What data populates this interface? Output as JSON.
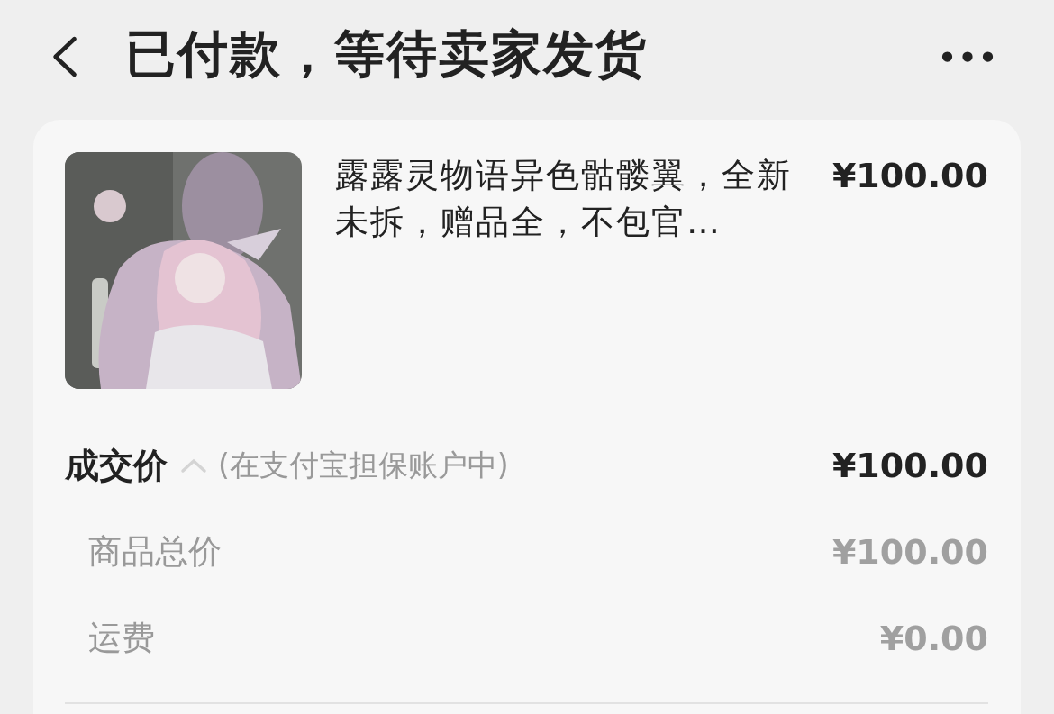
{
  "header": {
    "title": "已付款，等待卖家发货"
  },
  "item": {
    "kind": "picture",
    "title": "露露灵物语异色骷髅翼，全新未拆，赠品全，不包官…",
    "price": "¥100.00"
  },
  "deal": {
    "label": "成交价",
    "expanded": true,
    "note": "(在支付宝担保账户中)",
    "amount": "¥100.00"
  },
  "breakdown": [
    {
      "label": "商品总价",
      "amount": "¥100.00"
    },
    {
      "label": "运费",
      "amount": "¥0.00"
    }
  ]
}
